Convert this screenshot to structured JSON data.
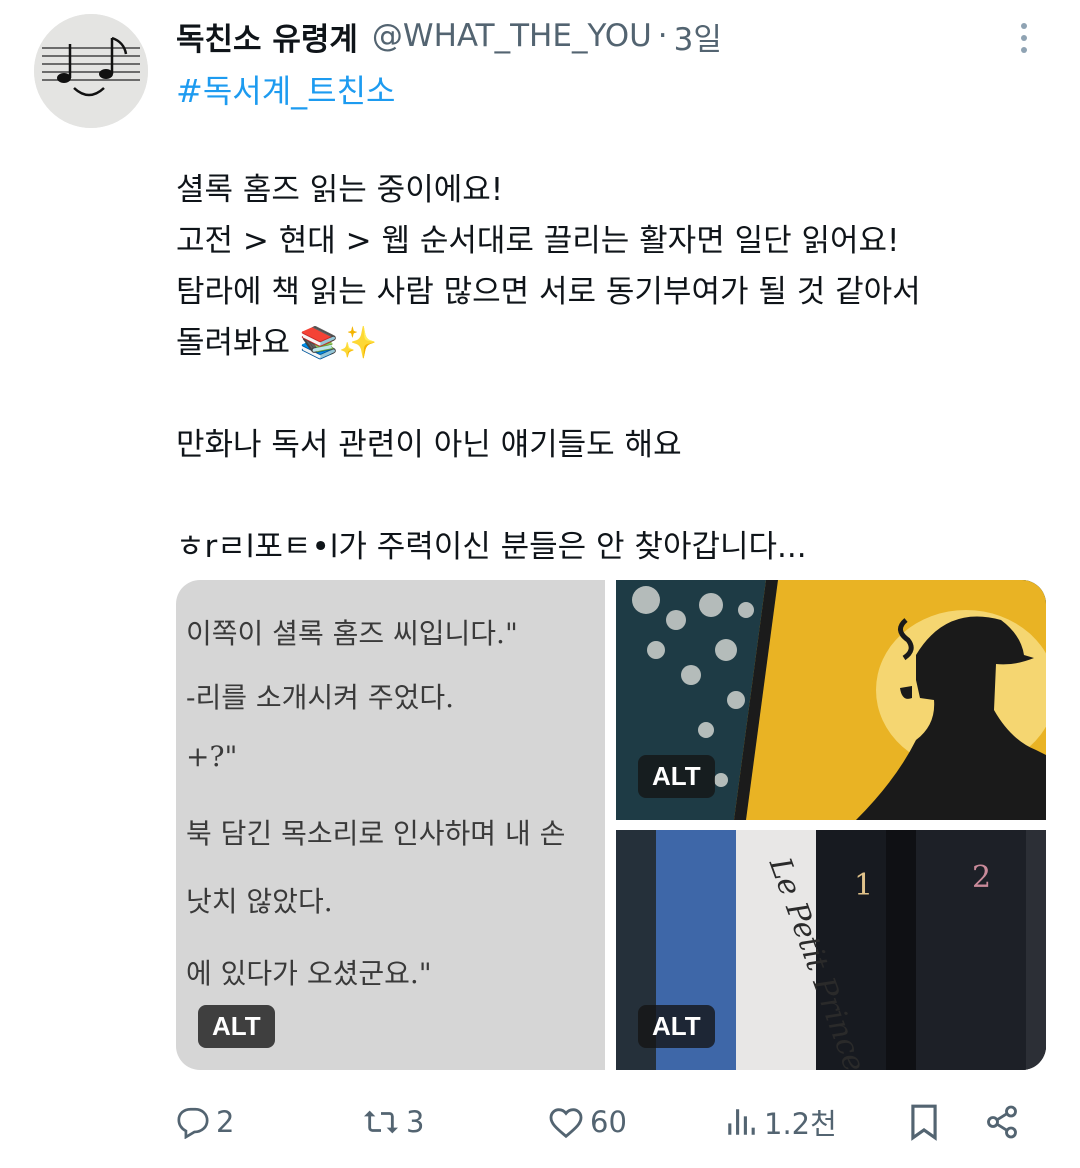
{
  "author": {
    "display_name": "독친소 유령계",
    "handle": "@WHAT_THE_YOU",
    "separator": "·",
    "time": "3일"
  },
  "tweet": {
    "hashtag": "#독서계_트친소",
    "lines": [
      "셜록 홈즈 읽는 중이에요!",
      "고전 > 현대 > 웹 순서대로 끌리는 활자면 일단 읽어요!",
      "탐라에 책 읽는 사람 많으면 서로 동기부여가 될 것 같아서",
      "돌려봐요 📚✨",
      "",
      "만화나 독서 관련이 아닌 얘기들도 해요",
      "",
      "ㅎrㄹl포ㅌ•l가 주력이신 분들은 안 찾아갑니다..."
    ]
  },
  "media": {
    "alt_label": "ALT",
    "left_image_text": [
      "이쪽이 셜록 홈즈 씨입니다.\"",
      "-리를 소개시켜 주었다.",
      "+?\"",
      "북 담긴 목소리로 인사하며 내 손",
      "낫치 않았다.",
      "에 있다가 오셨군요.\""
    ],
    "book_spine_text": [
      "Le Petit Prince",
      "1",
      "2"
    ]
  },
  "actions": {
    "replies": "2",
    "retweets": "3",
    "likes": "60",
    "views": "1.2천"
  },
  "colors": {
    "link": "#1d9bf0",
    "secondary": "#536471",
    "yellow": "#e9b324"
  }
}
